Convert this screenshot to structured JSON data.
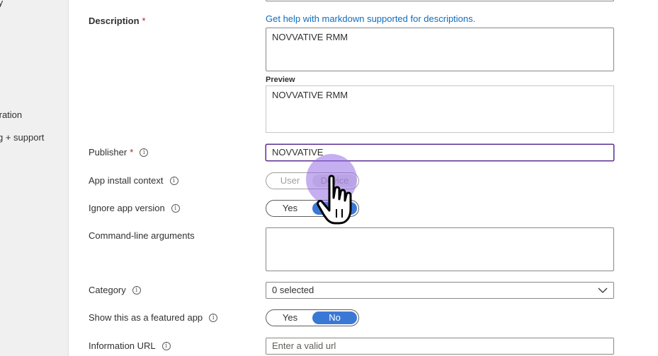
{
  "sidebar": {
    "items": [
      "ty",
      "tration",
      "g + support"
    ]
  },
  "form": {
    "description": {
      "label": "Description",
      "required": "*",
      "help_link": "Get help with markdown supported for descriptions.",
      "value": "NOVVATIVE RMM",
      "preview_label": "Preview",
      "preview_value": "NOVVATIVE RMM"
    },
    "publisher": {
      "label": "Publisher",
      "required": "*",
      "value": "NOVVATIVE"
    },
    "install_context": {
      "label": "App install context",
      "options": [
        "User",
        "Device"
      ],
      "selected": "Device",
      "disabled": true
    },
    "ignore_version": {
      "label": "Ignore app version",
      "options": [
        "Yes",
        "No"
      ],
      "selected": "No"
    },
    "command_line": {
      "label": "Command-line arguments",
      "value": ""
    },
    "category": {
      "label": "Category",
      "value": "0 selected"
    },
    "featured": {
      "label": "Show this as a featured app",
      "options": [
        "Yes",
        "No"
      ],
      "selected": "No"
    },
    "info_url": {
      "label": "Information URL",
      "placeholder": "Enter a valid url"
    }
  },
  "icons": {
    "info": "info-icon",
    "chevron": "chevron-down-icon",
    "cursor": "hand-pointer-icon"
  },
  "colors": {
    "accent": "#3a78d6",
    "link": "#0f6cbd",
    "required": "#a4262c",
    "focus_border": "#5c2d91",
    "cursor_highlight": "#9670e6"
  }
}
